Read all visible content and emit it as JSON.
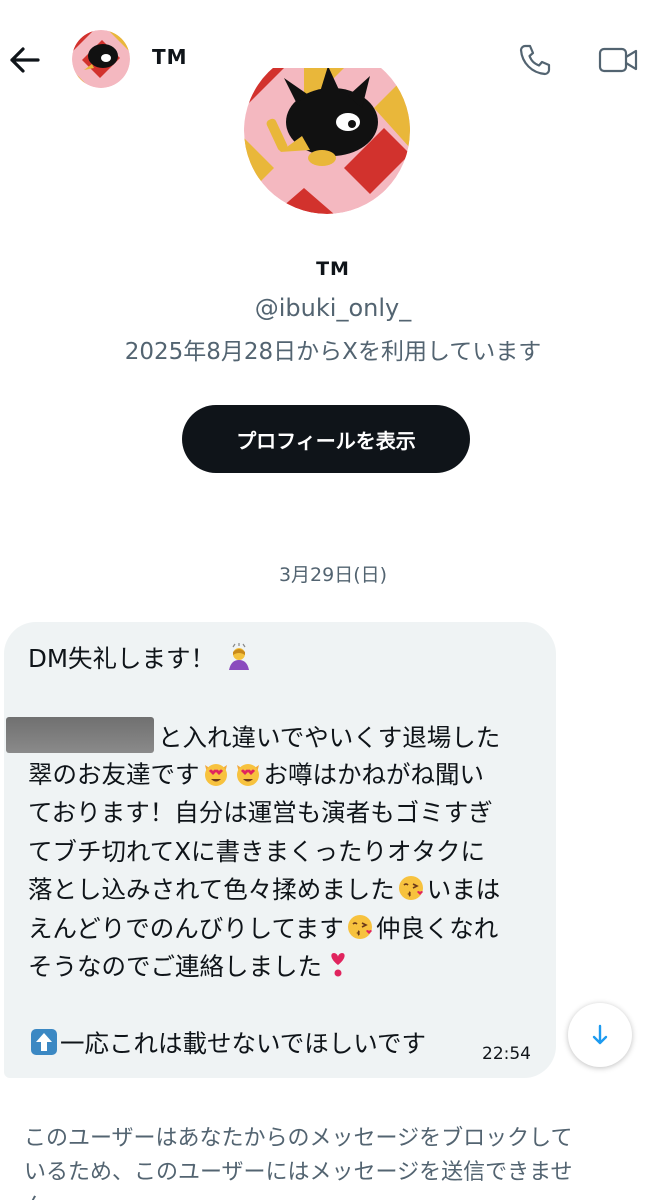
{
  "header": {
    "back_icon": "arrow-left-icon",
    "name": "TM",
    "call_icon": "phone-icon",
    "video_icon": "video-camera-icon"
  },
  "profile": {
    "name": "TM",
    "handle": "@ibuki_only_",
    "joined": "2025年8月28日からXを利用しています",
    "view_profile_label": "プロフィールを表示"
  },
  "conversation": {
    "date": "3月29日(日)",
    "message": {
      "line1": "DM失礼します！",
      "line3": "と入れ違いでやいくす退場した",
      "line4a": "翠のお友達です",
      "line4b": "お噂はかねがね聞い",
      "line5": "ております！自分は運営も演者もゴミすぎ",
      "line6": "てブチ切れてXに書きまくったりオタクに",
      "line7a": "落とし込みされて色々揉めました",
      "line7b": "いまは",
      "line8a": "えんどりでのんびりしてます",
      "line8b": "仲良くなれ",
      "line9": "そうなのでご連絡しました",
      "line11": "一応これは載せないでほしいです",
      "time": "22:54"
    }
  },
  "notice": {
    "blocked_line1": "このユーザーはあなたからのメッセージをブロックして",
    "blocked_line2": "いるため、このユーザーにはメッセージを送信できませ",
    "blocked_line3": "ん。"
  },
  "colors": {
    "primary_text": "#0f1419",
    "secondary_text": "#536471",
    "bubble": "#eff3f4",
    "accent": "#1d9bf0"
  }
}
